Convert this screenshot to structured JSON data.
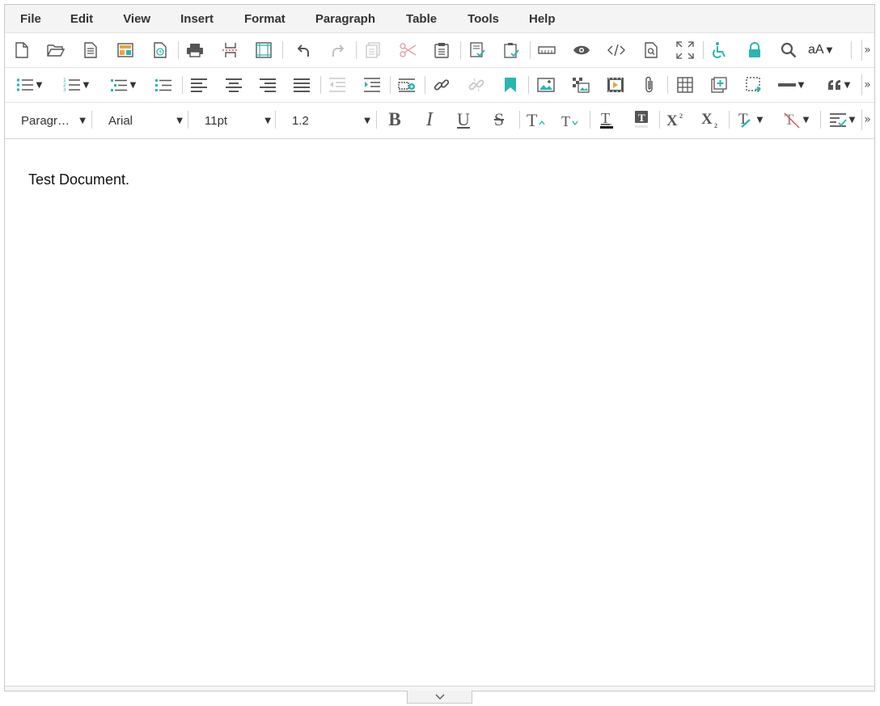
{
  "menubar": {
    "items": [
      "File",
      "Edit",
      "View",
      "Insert",
      "Format",
      "Paragraph",
      "Table",
      "Tools",
      "Help"
    ]
  },
  "toolbar1": {
    "icons": [
      "new-document-icon",
      "open-folder-icon",
      "document-icon",
      "templates-icon",
      "revision-history-icon",
      "print-icon",
      "page-break-icon",
      "page-layout-icon",
      "undo-icon",
      "redo-icon",
      "copy-icon",
      "cut-icon",
      "paste-icon",
      "track-changes-icon",
      "accept-changes-icon",
      "ruler-icon",
      "preview-icon",
      "source-code-icon",
      "find-in-document-icon",
      "fullscreen-icon",
      "accessibility-icon",
      "lock-icon",
      "search-icon"
    ],
    "case_label": "aA",
    "more": "»"
  },
  "toolbar2": {
    "icons": [
      "bulleted-list-icon",
      "numbered-list-icon",
      "multilevel-list-icon",
      "list-style-icon",
      "align-left-icon",
      "align-center-icon",
      "align-right-icon",
      "align-justify-icon",
      "outdent-icon",
      "indent-icon",
      "form-field-icon",
      "link-icon",
      "unlink-icon",
      "bookmark-icon",
      "image-icon",
      "object-icon",
      "video-icon",
      "attachment-icon",
      "table-icon",
      "insert-box-icon",
      "placeholder-icon",
      "horizontal-line-icon",
      "blockquote-icon"
    ],
    "more": "»"
  },
  "toolbar3": {
    "block_format": "Paragr…",
    "font_family": "Arial",
    "font_size": "11pt",
    "line_height": "1.2",
    "icons": [
      "bold-icon",
      "italic-icon",
      "underline-icon",
      "strikethrough-icon",
      "increase-font-icon",
      "decrease-font-icon",
      "text-color-icon",
      "highlight-color-icon",
      "superscript-icon",
      "subscript-icon",
      "clear-formatting-icon",
      "remove-format-icon",
      "styles-icon"
    ],
    "bold": "B",
    "italic": "I",
    "underline": "U",
    "strike": "S",
    "superscript": "X²",
    "subscript": "X₂",
    "more": "»"
  },
  "document": {
    "text": "Test Document."
  },
  "colors": {
    "accent": "#2bb5b0",
    "icon": "#555555",
    "menubar_bg": "#f4f4f4",
    "disabled": "#c0c0c0",
    "cut_disabled": "#e8a0a0"
  }
}
